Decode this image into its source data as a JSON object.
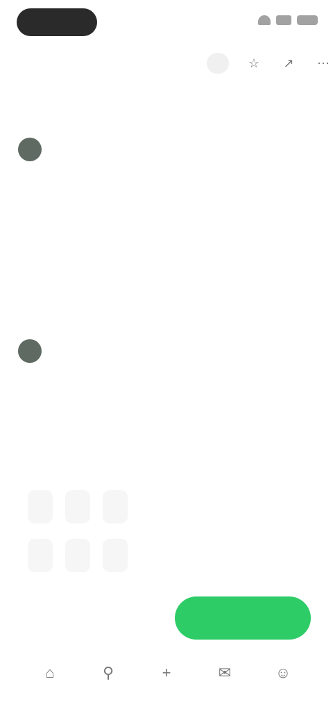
{
  "status": {
    "icons": [
      "wifi-icon",
      "signal-icon",
      "battery-icon"
    ]
  },
  "header": {
    "subtitle": "",
    "follow_label": "",
    "icons": [
      "bookmark-icon",
      "share-icon",
      "more-icon"
    ]
  },
  "reviews": {
    "title": "",
    "comments": [
      {
        "author": "",
        "lines": [
          "",
          "",
          ""
        ],
        "meta": [
          "",
          "",
          "",
          ""
        ]
      },
      {
        "author": "",
        "sub": ""
      }
    ]
  },
  "related": {
    "title": "",
    "chips_row1": [
      "",
      "",
      ""
    ],
    "chips_row2": [
      "",
      "",
      ""
    ]
  },
  "action_bar": {
    "price": "",
    "price_sub": "",
    "cta_label": ""
  },
  "bottom_nav": [
    {
      "icon": "home-icon",
      "label": ""
    },
    {
      "icon": "search-icon",
      "label": ""
    },
    {
      "icon": "add-icon",
      "label": ""
    },
    {
      "icon": "message-icon",
      "label": ""
    },
    {
      "icon": "profile-icon",
      "label": ""
    }
  ],
  "colors": {
    "accent": "#2ecc66",
    "dark": "#2a2a2a",
    "avatar": "#5f6b62"
  }
}
